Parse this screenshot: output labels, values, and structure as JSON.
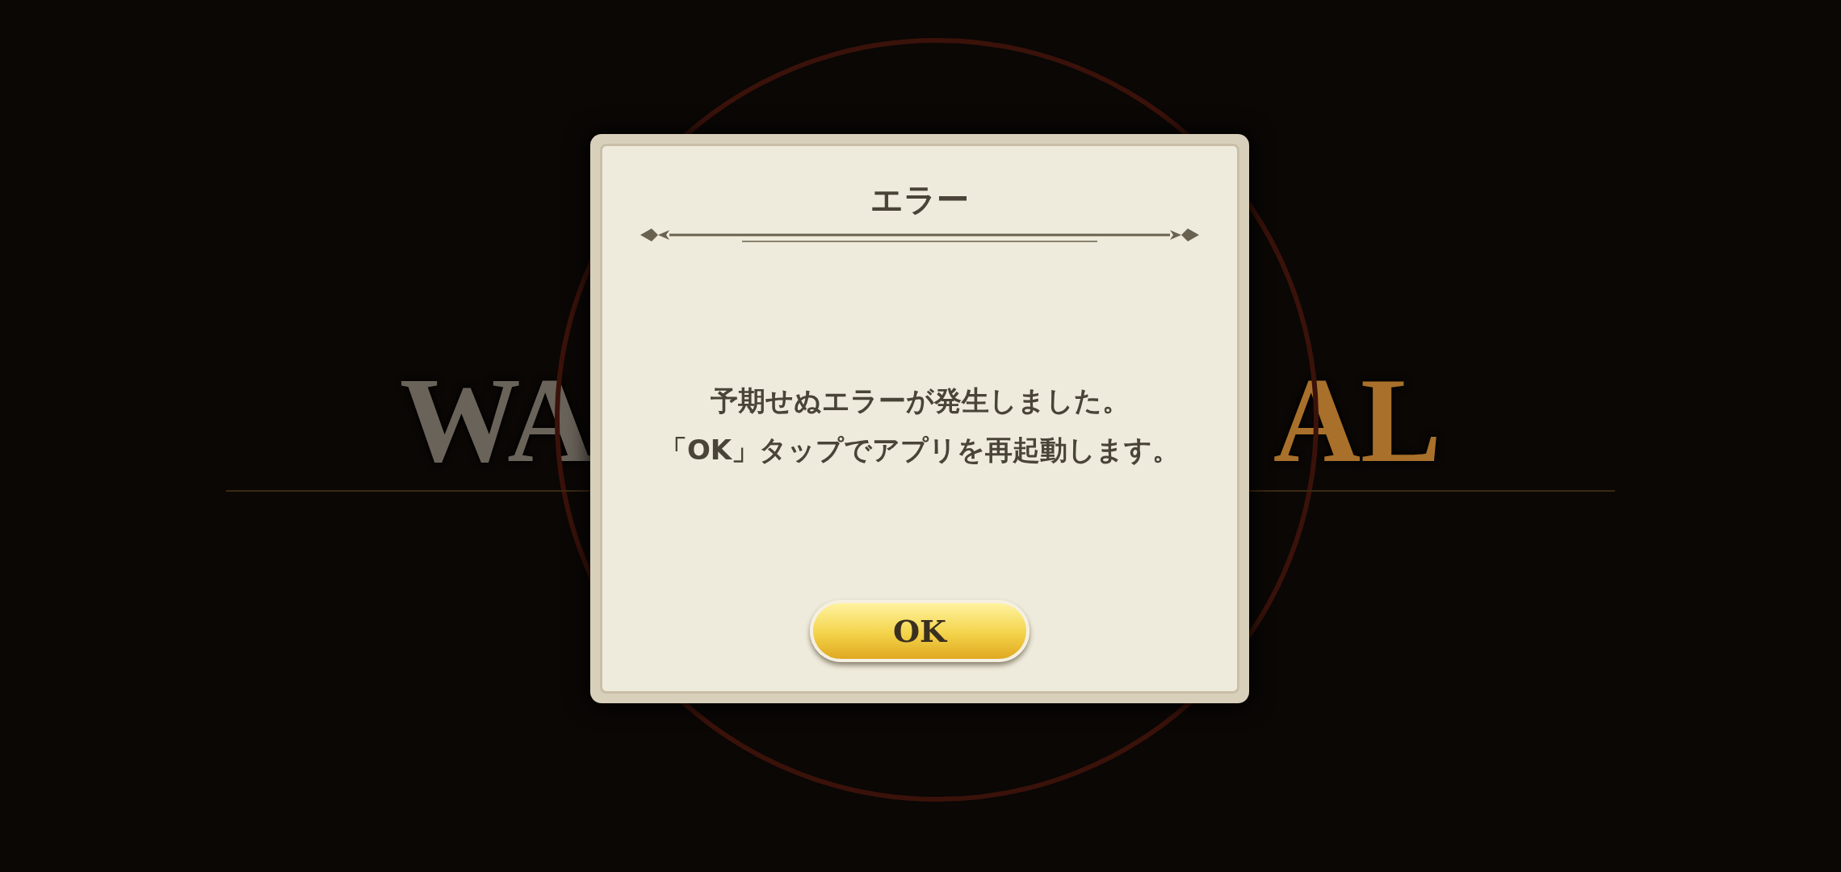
{
  "background_logo": {
    "left_part": "WA",
    "right_part": "AL"
  },
  "dialog": {
    "title": "エラー",
    "message_lines": [
      "予期せぬエラーが発生しました。",
      "「OK」タップでアプリを再起動します。"
    ],
    "button": "OK"
  }
}
